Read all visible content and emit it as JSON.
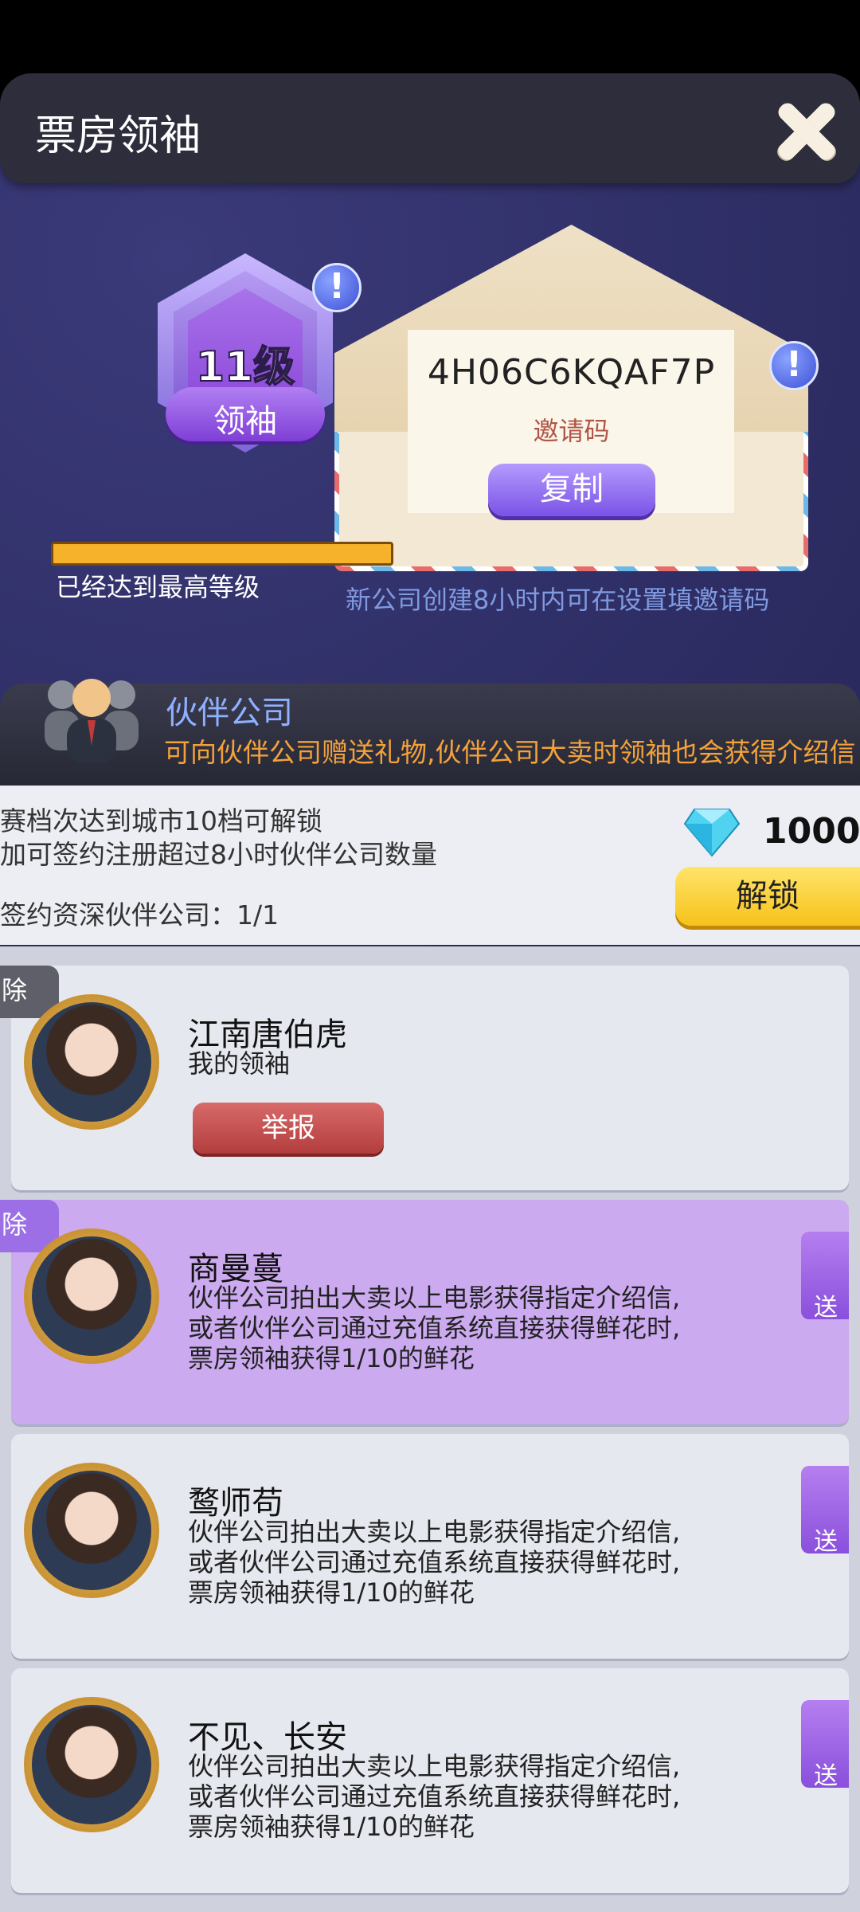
{
  "header": {
    "title": "票房领袖"
  },
  "leader": {
    "level": "11级",
    "rank": "领袖",
    "max_level_text": "已经达到最高等级",
    "progress": 1.0
  },
  "invite": {
    "code": "4H06C6KQAF7P",
    "code_label": "邀请码",
    "copy_label": "复制",
    "hint": "新公司创建8小时内可在设置填邀请码"
  },
  "partner": {
    "title": "伙伴公司",
    "desc": "可向伙伴公司赠送礼物,伙伴公司大卖时领袖也会获得介绍信",
    "unlock_line1": "赛档次达到城市10档可解锁",
    "unlock_line2": "加可签约注册超过8小时伙伴公司数量",
    "signed_count": "签约资深伙伴公司：1/1",
    "cost": "1000",
    "unlock_label": "解锁"
  },
  "partners": [
    {
      "tag": "除",
      "name": "江南唐伯虎",
      "desc": "我的领袖",
      "action": "举报",
      "highlight": false
    },
    {
      "tag": "除",
      "name": "商曼蔓",
      "desc": "伙伴公司拍出大卖以上电影获得指定介绍信,\n或者伙伴公司通过充值系统直接获得鲜花时,\n票房领袖获得1/10的鲜花",
      "gift": "送",
      "highlight": true
    },
    {
      "name": "鹜师苟",
      "desc": "伙伴公司拍出大卖以上电影获得指定介绍信,\n或者伙伴公司通过充值系统直接获得鲜花时,\n票房领袖获得1/10的鲜花",
      "gift": "送",
      "highlight": false
    },
    {
      "name": "不见、长安",
      "desc": "伙伴公司拍出大卖以上电影获得指定介绍信,\n或者伙伴公司通过充值系统直接获得鲜花时,\n票房领袖获得1/10的鲜花",
      "gift": "送",
      "highlight": false
    }
  ],
  "colors": {
    "accent_purple": "#8a4fdc",
    "gold": "#f7c21a",
    "hint_blue": "#7f9ae0",
    "orange": "#f3a23a"
  }
}
